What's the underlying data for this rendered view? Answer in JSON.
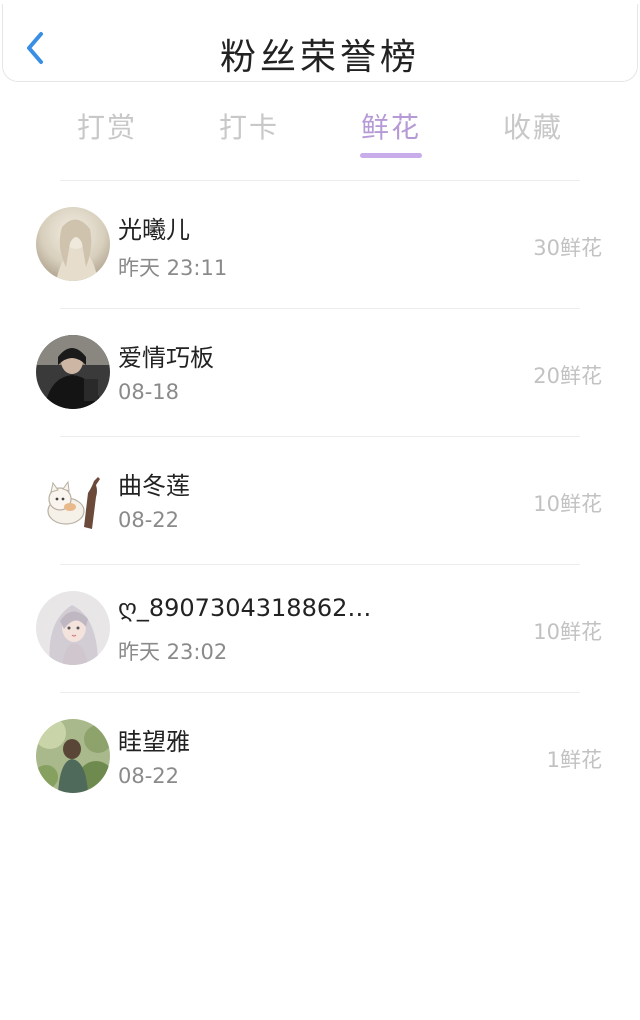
{
  "header": {
    "title": "粉丝荣誉榜",
    "back_icon": "chevron-left-icon",
    "accent_color": "#3a8ee6"
  },
  "tabs": [
    {
      "label": "打赏",
      "active": false
    },
    {
      "label": "打卡",
      "active": false
    },
    {
      "label": "鲜花",
      "active": true
    },
    {
      "label": "收藏",
      "active": false
    }
  ],
  "active_tab_color": "#b59ad6",
  "fans": [
    {
      "name": "光曦儿",
      "time": "昨天 23:11",
      "amount": "30鲜花"
    },
    {
      "name": "爱情巧板",
      "time": "08-18",
      "amount": "20鲜花"
    },
    {
      "name": "曲冬莲",
      "time": "08-22",
      "amount": "10鲜花"
    },
    {
      "name": "ღ_8907304318862…",
      "time": "昨天 23:02",
      "amount": "10鲜花"
    },
    {
      "name": "眭望雅",
      "time": "08-22",
      "amount": "1鲜花"
    }
  ]
}
